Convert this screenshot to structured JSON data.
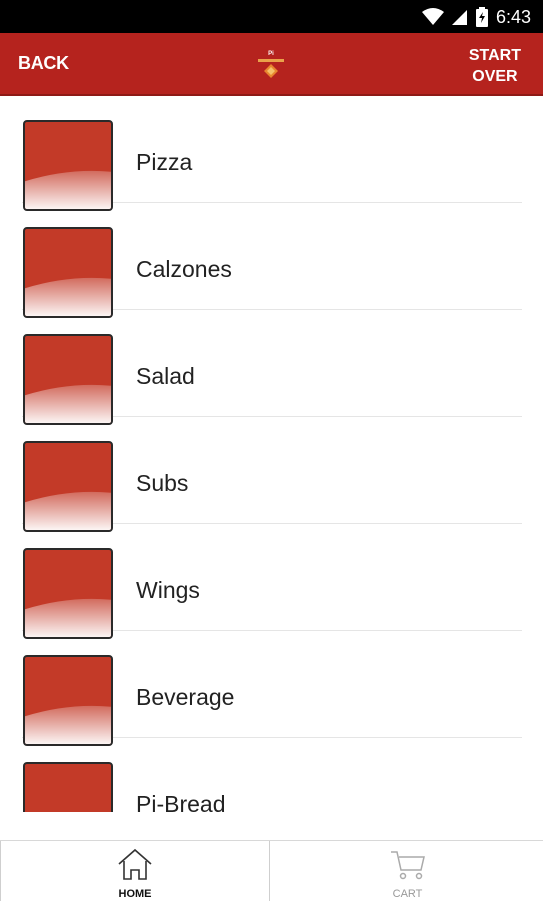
{
  "status_bar": {
    "time": "6:43",
    "icons": [
      "wifi-icon",
      "signal-icon",
      "battery-icon"
    ]
  },
  "app_bar": {
    "back_label": "BACK",
    "start_over_line1": "START",
    "start_over_line2": "OVER",
    "logo_text": "Pi"
  },
  "menu": {
    "items": [
      {
        "label": "Pizza"
      },
      {
        "label": "Calzones"
      },
      {
        "label": "Salad"
      },
      {
        "label": "Subs"
      },
      {
        "label": "Wings"
      },
      {
        "label": "Beverage"
      },
      {
        "label": "Pi-Bread"
      }
    ]
  },
  "bottom_nav": {
    "home_label": "HOME",
    "cart_label": "CART"
  },
  "colors": {
    "brand_red": "#b5231e",
    "thumb_red": "#c33a28"
  }
}
